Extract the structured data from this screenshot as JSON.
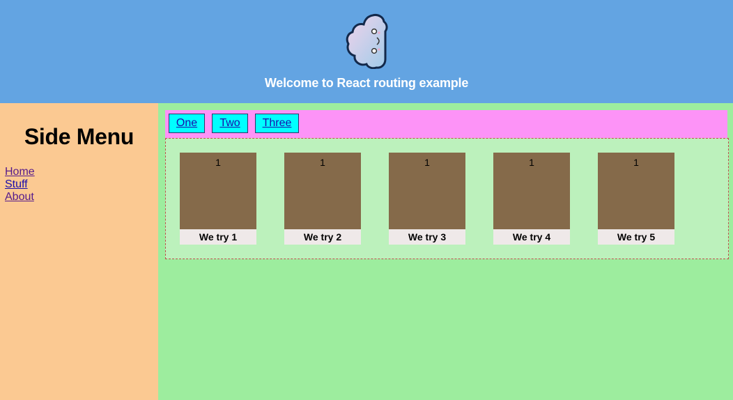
{
  "header": {
    "welcome": "Welcome to React routing example",
    "logo_icon": "cloud-face-logo",
    "background": "#63a4e2"
  },
  "sidebar": {
    "title": "Side Menu",
    "links": [
      {
        "label": "Home"
      },
      {
        "label": "Stuff"
      },
      {
        "label": "About"
      }
    ],
    "background": "#fbc992"
  },
  "tabs": [
    {
      "label": "One"
    },
    {
      "label": "Two"
    },
    {
      "label": "Three"
    }
  ],
  "cards": [
    {
      "number": "1",
      "caption": "We try 1"
    },
    {
      "number": "1",
      "caption": "We try 2"
    },
    {
      "number": "1",
      "caption": "We try 3"
    },
    {
      "number": "1",
      "caption": "We try 4"
    },
    {
      "number": "1",
      "caption": "We try 5"
    }
  ],
  "colors": {
    "main_bg": "#9ded9e",
    "tabbar_bg": "#fd93f7",
    "tab_bg": "#00ffff",
    "content_bg": "#bcf1bc",
    "card_bg": "#856a4a",
    "caption_bg": "#efe9e9"
  }
}
